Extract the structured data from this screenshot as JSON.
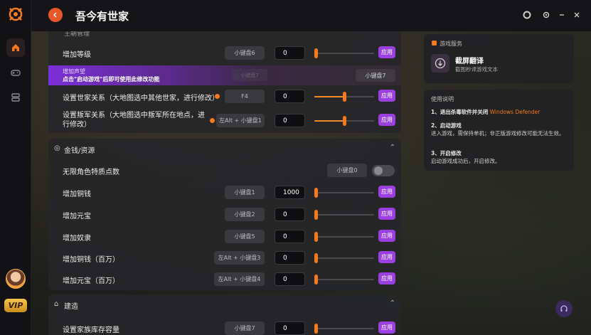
{
  "app": {
    "title": "吾今有世家"
  },
  "main": {
    "clipped_top_label": "王朝管理",
    "top_rows": [
      {
        "label": "增加等级",
        "key": "小键盘6",
        "value": "0",
        "slider": 0.0,
        "apply": "应用"
      }
    ],
    "banner": {
      "label": "增加声望",
      "notice": "点击\"启动游戏\"后即可使用此修改功能",
      "key": "小键盘7",
      "dim_key": "小键盘7"
    },
    "relation_rows": [
      {
        "label": "设置世家关系（大地图选中其他世家，进行修改）",
        "key": "F4",
        "value": "0",
        "slider": 0.5,
        "apply": "应用"
      },
      {
        "label": "设置叛军关系（大地图选中叛军所在地点，进行修改）",
        "key": "左Alt + 小键盘1",
        "value": "0",
        "slider": 0.5,
        "apply": "应用"
      }
    ],
    "money_section": {
      "title": "金钱/资源",
      "toggle_row": {
        "label": "无限角色特质点数",
        "key": "小键盘0",
        "on": false
      },
      "rows": [
        {
          "label": "增加铜钱",
          "key": "小键盘1",
          "value": "1000",
          "slider": 0.0,
          "apply": "应用"
        },
        {
          "label": "增加元宝",
          "key": "小键盘2",
          "value": "0",
          "slider": 0.0,
          "apply": "应用"
        },
        {
          "label": "增加奴隶",
          "key": "小键盘5",
          "value": "0",
          "slider": 0.0,
          "apply": "应用"
        },
        {
          "label": "增加铜钱（百万）",
          "key": "左Alt + 小键盘3",
          "value": "0",
          "slider": 0.0,
          "apply": "应用"
        },
        {
          "label": "增加元宝（百万）",
          "key": "左Alt + 小键盘4",
          "value": "0",
          "slider": 0.0,
          "apply": "应用"
        }
      ]
    },
    "build_section": {
      "title": "建造",
      "rows": [
        {
          "label": "设置家族库存容量",
          "key": "小键盘7",
          "value": "0",
          "slider": 0.0,
          "apply": "应用"
        }
      ]
    }
  },
  "side": {
    "service_title": "游戏服务",
    "service_name": "截屏翻译",
    "service_desc": "截图秒译游戏文本",
    "help_title": "使用说明",
    "step1_prefix": "1、退出杀毒软件并关闭",
    "step1_link": "Windows Defender",
    "step2_title": "2、启动游戏",
    "step2_body": "进入游戏，需保持单机；非正版游戏修改可能无法生效。",
    "step3_title": "3、开启修改",
    "step3_body": "启动游戏成功后，开启修改。"
  },
  "rail": {
    "vip": "VIP"
  },
  "colors": {
    "accent": "#f47a1f",
    "apply": "#9a3fe0",
    "banner": "#7b2fd8"
  }
}
